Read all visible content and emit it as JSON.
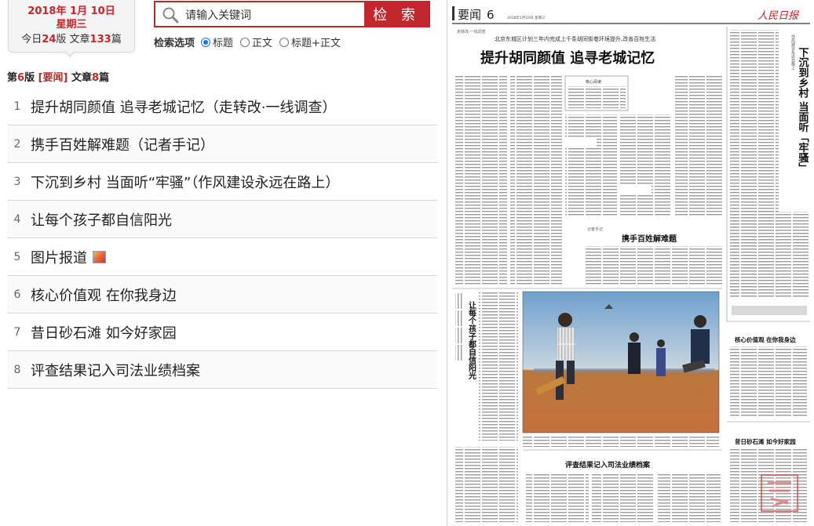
{
  "date": {
    "year": "2018",
    "year_suffix": "年",
    "month": "1",
    "month_suffix": "月",
    "day": "10",
    "day_suffix": "日",
    "weekday": "星期三",
    "today_prefix": "今日",
    "pages": "24",
    "pages_suffix": "版 文章",
    "articles": "133",
    "articles_suffix": "篇"
  },
  "search": {
    "placeholder": "请输入关键词",
    "button": "检 索",
    "options_label": "检索选项",
    "options": [
      "标题",
      "正文",
      "标题+正文"
    ],
    "selected": "标题"
  },
  "summary": {
    "prefix": "第",
    "page": "6",
    "page_suffix": "版 ",
    "section": "[要闻]",
    "middle": " 文章",
    "count": "8",
    "suffix": "篇"
  },
  "articles": [
    {
      "num": "1",
      "title": "提升胡同颜值  追寻老城记忆（走转改·一线调查）",
      "has_image": false
    },
    {
      "num": "2",
      "title": "携手百姓解难题（记者手记）",
      "has_image": false
    },
    {
      "num": "3",
      "title": "下沉到乡村  当面听“牢骚”（作风建设永远在路上）",
      "has_image": false
    },
    {
      "num": "4",
      "title": "让每个孩子都自信阳光",
      "has_image": false
    },
    {
      "num": "5",
      "title": "图片报道",
      "has_image": true
    },
    {
      "num": "6",
      "title": "核心价值观  在你我身边",
      "has_image": false
    },
    {
      "num": "7",
      "title": "昔日砂石滩  如今好家园",
      "has_image": false
    },
    {
      "num": "8",
      "title": "评查结果记入司法业绩档案",
      "has_image": false
    }
  ],
  "paper": {
    "section": "要闻",
    "page": "6",
    "masthead": "人民日报",
    "dateline": "2018年1月10日  星期三",
    "kicker": "走转改·一线调查",
    "subhead": "北京东城区计划三年内完成上千条胡同街巷环境提升,改善百姓生活",
    "headline": "提升胡同颜值  追寻老城记忆",
    "side_head": "下沉到乡村  当面听「牢骚」",
    "side_kicker": "作风建设永远在路上",
    "section_kicker_left": "记者手记",
    "head2": "携手百姓解难题",
    "head4": "让每个孩子都自信阳光",
    "head6": "核心价值观  在你我身边",
    "head7": "昔日砂石滩  如今好家园",
    "head8": "评查结果记入司法业绩档案",
    "label_core": "核心阅读"
  }
}
